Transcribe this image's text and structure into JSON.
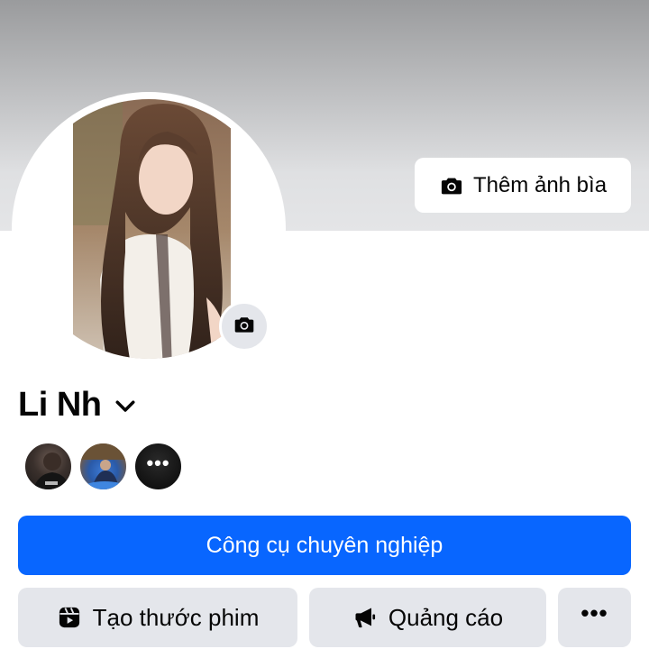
{
  "cover": {
    "add_cover_label": "Thêm ảnh bìa"
  },
  "profile": {
    "name": "Li Nh"
  },
  "friends": {
    "more_label": "•••"
  },
  "actions": {
    "professional_tools_label": "Công cụ chuyên nghiệp",
    "create_reel_label": "Tạo thước phim",
    "ads_label": "Quảng cáo",
    "more_label": "•••"
  },
  "icons": {
    "add_cover": "camera-icon",
    "avatar_edit": "camera-icon",
    "name_menu": "chevron-down-icon",
    "reel": "reel-icon",
    "ads": "megaphone-icon",
    "more": "more-icon"
  },
  "colors": {
    "primary": "#0866ff",
    "secondary_button": "#e4e6eb",
    "text": "#050505"
  }
}
